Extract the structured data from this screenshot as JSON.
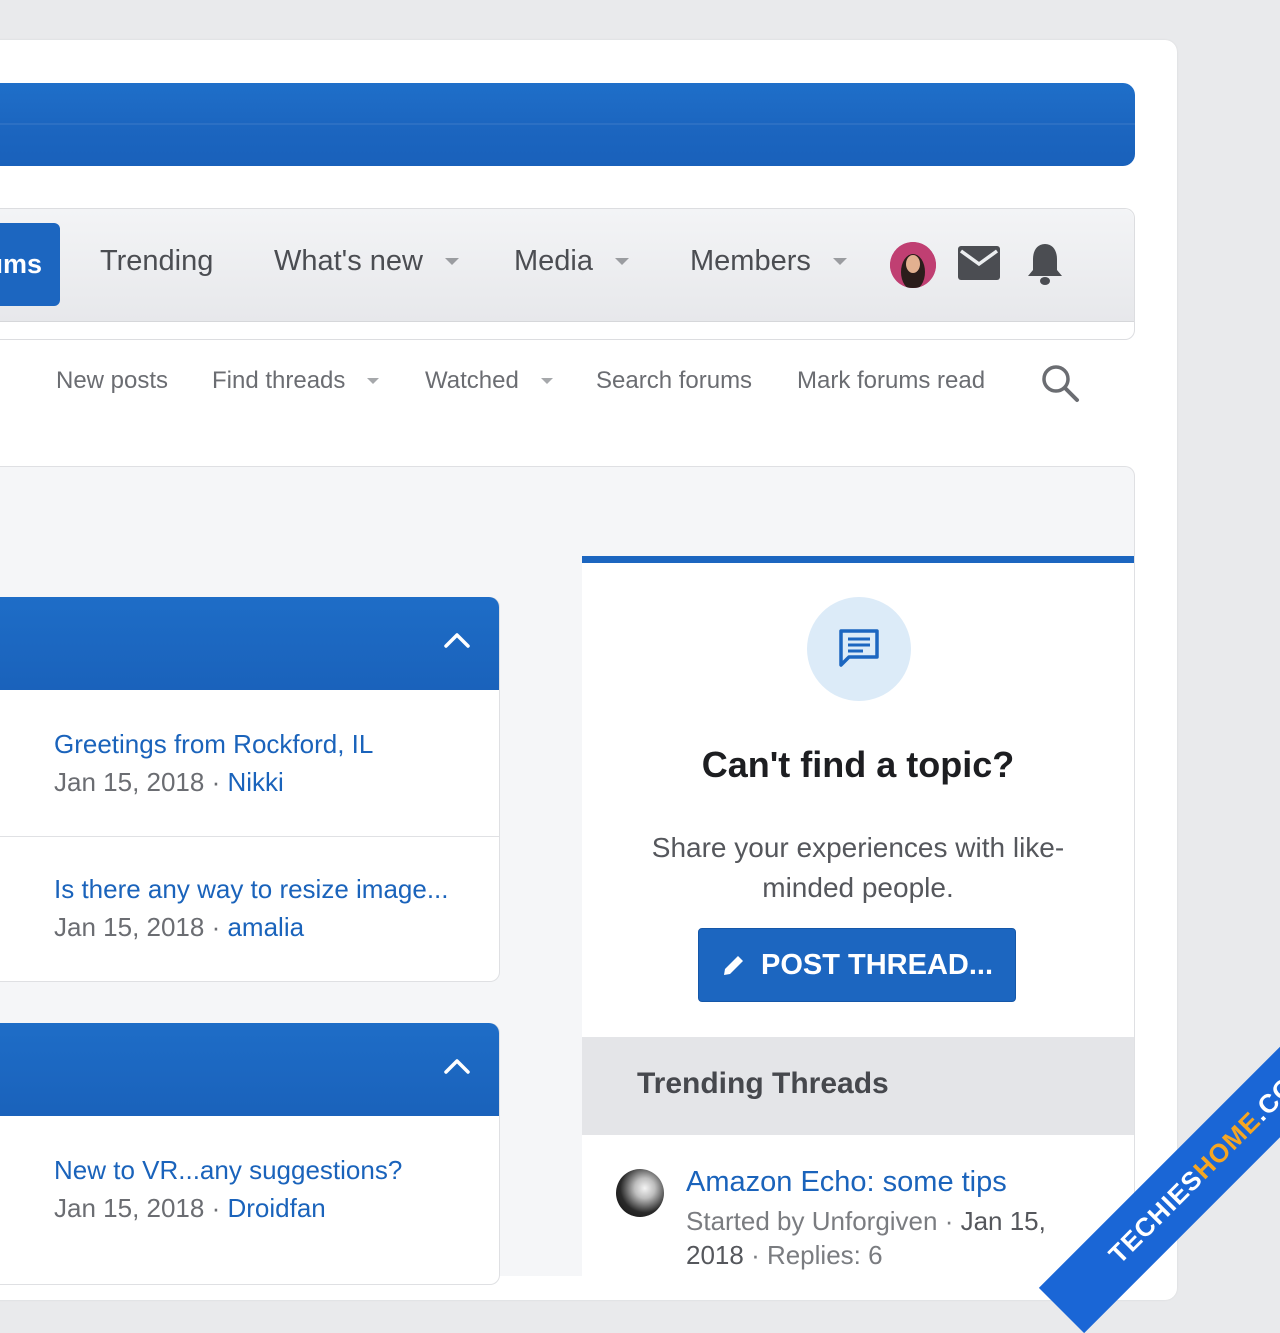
{
  "nav": {
    "active_label": "ums",
    "items": [
      {
        "label": "Trending"
      },
      {
        "label": "What's new"
      },
      {
        "label": "Media"
      },
      {
        "label": "Members"
      }
    ]
  },
  "subnav": {
    "items": [
      {
        "label": "New posts"
      },
      {
        "label": "Find threads"
      },
      {
        "label": "Watched"
      },
      {
        "label": "Search forums"
      },
      {
        "label": "Mark forums read"
      }
    ]
  },
  "blocks": [
    {
      "rows": [
        {
          "title": "Greetings from Rockford, IL",
          "date": "Jan 15, 2018",
          "sep": " · ",
          "user": "Nikki"
        },
        {
          "title": "Is there any way to resize image...",
          "date": "Jan 15, 2018",
          "sep": " · ",
          "user": "amalia"
        }
      ]
    },
    {
      "rows": [
        {
          "title": "New to VR...any suggestions?",
          "date": "Jan 15, 2018",
          "sep": " · ",
          "user": "Droidfan"
        }
      ]
    }
  ],
  "cta": {
    "title": "Can't find a topic?",
    "text": "Share your experiences with like-minded people.",
    "button": "POST THREAD..."
  },
  "trending": {
    "heading": "Trending Threads",
    "thread": {
      "title": "Amazon Echo: some tips",
      "meta_prefix": "Started by Unforgiven · ",
      "date": "Jan 15, 2018",
      "replies": " · Replies: 6"
    }
  },
  "watermark": {
    "main": "TECHIES",
    "accent": "HOME",
    "suffix": ".COM"
  },
  "colors": {
    "brand_blue": "#1c66c0",
    "link_blue": "#1a63bb"
  }
}
